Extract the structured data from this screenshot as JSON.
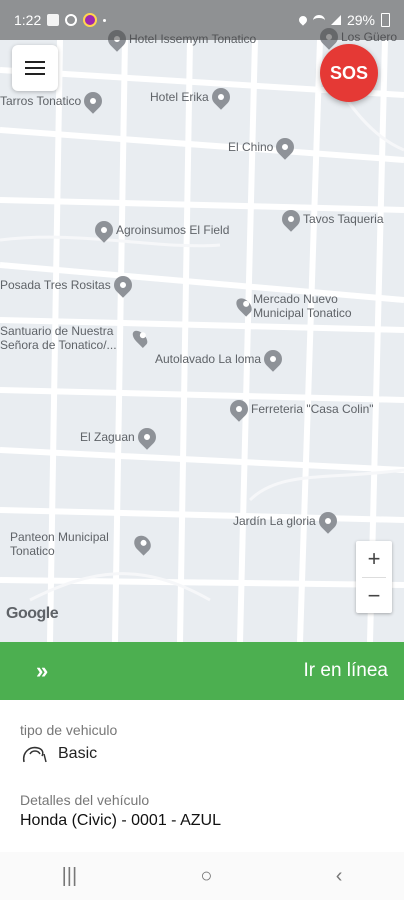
{
  "status": {
    "time": "1:22",
    "battery": "29%",
    "icons_left": [
      "image-icon",
      "b-icon",
      "avatar-icon",
      "dot-icon"
    ],
    "icons_right": [
      "location-icon",
      "wifi-icon",
      "signal-icon",
      "battery-icon"
    ]
  },
  "map": {
    "menu_icon": "menu-icon",
    "sos_label": "SOS",
    "pois": [
      {
        "name": "Hotel Issemym Tonatico",
        "icon": "hotel-icon"
      },
      {
        "name": "Los Güero",
        "icon": "restaurant-icon"
      },
      {
        "name": "Tarros Tonatico",
        "icon": "bar-icon"
      },
      {
        "name": "Hotel Erika",
        "icon": "hotel-icon"
      },
      {
        "name": "El Chino",
        "icon": "restaurant-icon"
      },
      {
        "name": "Agroinsumos El Field",
        "icon": "shop-icon"
      },
      {
        "name": "Tavos Taqueria",
        "icon": "restaurant-icon"
      },
      {
        "name": "Posada Tres Rositas",
        "icon": "hotel-icon"
      },
      {
        "name": "Mercado Nuevo Municipal Tonatico",
        "icon": "shopping-cart-icon"
      },
      {
        "name": "Santuario de Nuestra Señora de Tonatico/...",
        "icon": "church-icon"
      },
      {
        "name": "Autolavado La loma",
        "icon": "place-icon"
      },
      {
        "name": "Ferreteria \"Casa Colin\"",
        "icon": "shop-icon"
      },
      {
        "name": "El Zaguan",
        "icon": "restaurant-icon"
      },
      {
        "name": "Jardín La gloria",
        "icon": "bar-icon"
      },
      {
        "name": "Panteon Municipal Tonatico",
        "icon": "cemetery-icon"
      }
    ],
    "zoom_in": "+",
    "zoom_out": "−",
    "attribution": "Google"
  },
  "online": {
    "chevron": "»",
    "label": "Ir en línea"
  },
  "vehicle": {
    "type_label": "tipo de vehiculo",
    "type_value": "Basic",
    "details_label": "Detalles del vehículo",
    "details_value": "Honda (Civic) - 0001 - AZUL"
  },
  "nav": {
    "recent": "|||",
    "home": "○",
    "back": "‹"
  },
  "colors": {
    "online_green": "#4caf50",
    "sos_red": "#e53935"
  }
}
